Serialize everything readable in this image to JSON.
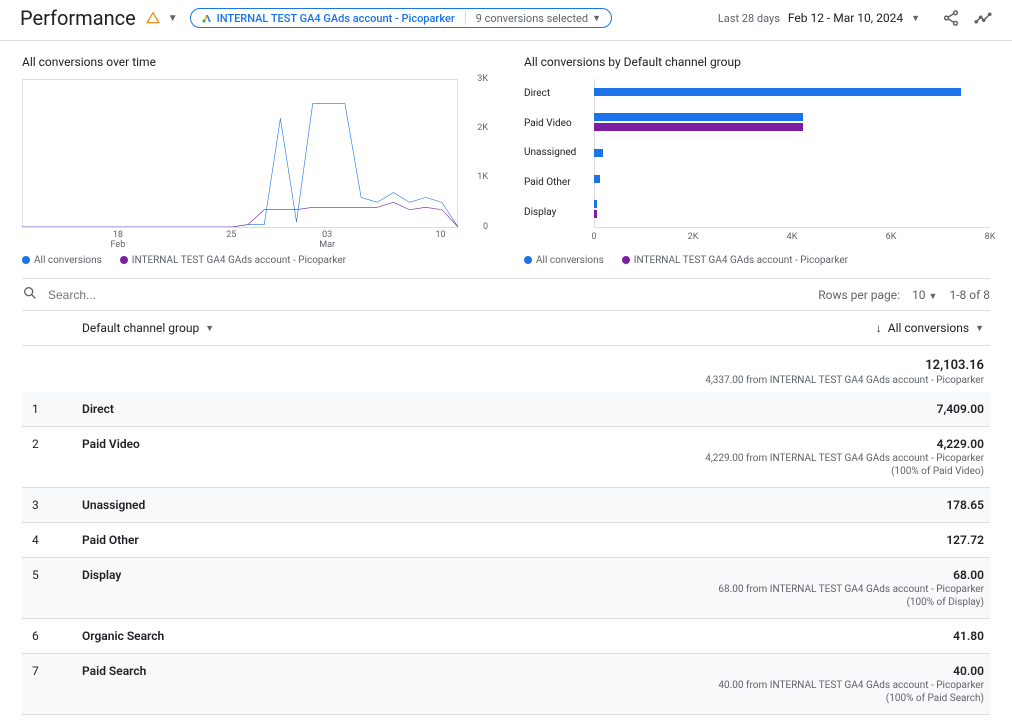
{
  "header": {
    "title": "Performance",
    "filter_pill": {
      "account_label": "INTERNAL TEST GA4 GAds account - Picoparker",
      "selection_label": "9 conversions selected"
    },
    "date": {
      "label": "Last 28 days",
      "range": "Feb 12 - Mar 10, 2024"
    }
  },
  "line_chart": {
    "title": "All conversions over time",
    "y_ticks": [
      "0",
      "1K",
      "2K",
      "3K"
    ],
    "x_tick_dates": [
      "18",
      "25",
      "03",
      "10"
    ],
    "x_tick_months": [
      "Feb",
      "",
      "Mar",
      ""
    ],
    "legend": [
      "All conversions",
      "INTERNAL TEST GA4 GAds account - Picoparker"
    ]
  },
  "bar_chart": {
    "title": "All conversions by Default channel group",
    "x_ticks": [
      "0",
      "2K",
      "4K",
      "6K",
      "8K"
    ],
    "legend": [
      "All conversions",
      "INTERNAL TEST GA4 GAds account - Picoparker"
    ]
  },
  "table": {
    "search_placeholder": "Search...",
    "rows_per_page_label": "Rows per page:",
    "rows_per_page_value": "10",
    "range_label": "1-8 of 8",
    "dimension_label": "Default channel group",
    "metric_label": "All conversions",
    "totals": {
      "value": "12,103.16",
      "sub": "4,337.00 from INTERNAL TEST GA4 GAds account - Picoparker"
    },
    "rows": [
      {
        "idx": "1",
        "dim": "Direct",
        "value": "7,409.00",
        "sub": ""
      },
      {
        "idx": "2",
        "dim": "Paid Video",
        "value": "4,229.00",
        "sub": "4,229.00 from INTERNAL TEST GA4 GAds account - Picoparker\n(100% of Paid Video)"
      },
      {
        "idx": "3",
        "dim": "Unassigned",
        "value": "178.65",
        "sub": ""
      },
      {
        "idx": "4",
        "dim": "Paid Other",
        "value": "127.72",
        "sub": ""
      },
      {
        "idx": "5",
        "dim": "Display",
        "value": "68.00",
        "sub": "68.00 from INTERNAL TEST GA4 GAds account - Picoparker\n(100% of Display)"
      },
      {
        "idx": "6",
        "dim": "Organic Search",
        "value": "41.80",
        "sub": ""
      },
      {
        "idx": "7",
        "dim": "Paid Search",
        "value": "40.00",
        "sub": "40.00 from INTERNAL TEST GA4 GAds account - Picoparker\n(100% of Paid Search)"
      }
    ]
  },
  "chart_data": [
    {
      "type": "line",
      "title": "All conversions over time",
      "xlabel": "",
      "ylabel": "",
      "ylim": [
        0,
        3000
      ],
      "x": [
        "Feb 12",
        "Feb 13",
        "Feb 14",
        "Feb 15",
        "Feb 16",
        "Feb 17",
        "Feb 18",
        "Feb 19",
        "Feb 20",
        "Feb 21",
        "Feb 22",
        "Feb 23",
        "Feb 24",
        "Feb 25",
        "Feb 26",
        "Feb 27",
        "Feb 28",
        "Feb 29",
        "Mar 01",
        "Mar 02",
        "Mar 03",
        "Mar 04",
        "Mar 05",
        "Mar 06",
        "Mar 07",
        "Mar 08",
        "Mar 09",
        "Mar 10"
      ],
      "series": [
        {
          "name": "All conversions",
          "color": "#1a73e8",
          "values": [
            0,
            0,
            0,
            0,
            0,
            0,
            0,
            0,
            0,
            0,
            0,
            0,
            0,
            0,
            50,
            50,
            2200,
            100,
            2500,
            2500,
            2500,
            600,
            500,
            700,
            500,
            600,
            500,
            0
          ]
        },
        {
          "name": "INTERNAL TEST GA4 GAds account - Picoparker",
          "color": "#7b1fa2",
          "values": [
            0,
            0,
            0,
            0,
            0,
            0,
            0,
            0,
            0,
            0,
            0,
            0,
            0,
            0,
            50,
            350,
            350,
            350,
            400,
            400,
            400,
            400,
            400,
            500,
            350,
            400,
            350,
            0
          ]
        }
      ]
    },
    {
      "type": "bar",
      "orientation": "horizontal",
      "title": "All conversions by Default channel group",
      "xlabel": "",
      "ylabel": "",
      "xlim": [
        0,
        8000
      ],
      "categories": [
        "Direct",
        "Paid Video",
        "Unassigned",
        "Paid Other",
        "Display"
      ],
      "series": [
        {
          "name": "All conversions",
          "color": "#1a73e8",
          "values": [
            7409,
            4229,
            179,
            128,
            68
          ]
        },
        {
          "name": "INTERNAL TEST GA4 GAds account - Picoparker",
          "color": "#7b1fa2",
          "values": [
            0,
            4229,
            0,
            0,
            68
          ]
        }
      ]
    }
  ]
}
